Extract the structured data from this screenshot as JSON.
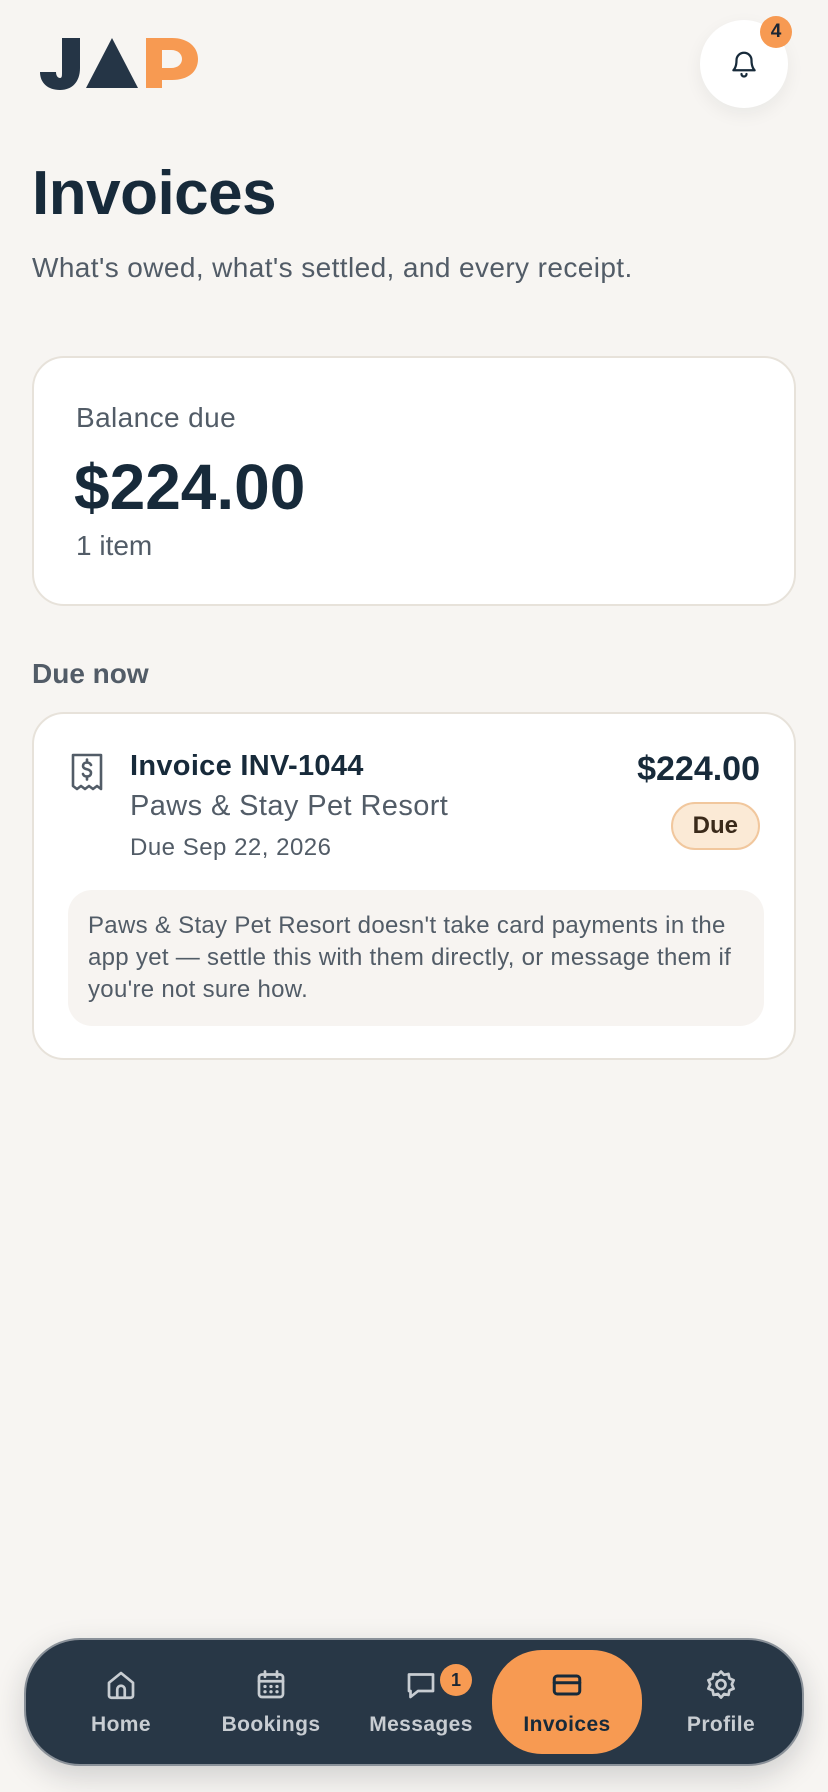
{
  "header": {
    "logo_text": "JAP",
    "notifications_count": "4"
  },
  "page": {
    "title": "Invoices",
    "subtitle": "What's owed, what's settled, and every receipt."
  },
  "balance": {
    "label": "Balance due",
    "amount": "$224.00",
    "count": "1 item"
  },
  "due_now": {
    "section_label": "Due now",
    "invoices": [
      {
        "title": "Invoice INV-1044",
        "vendor": "Paws & Stay Pet Resort",
        "due_date": "Due Sep 22, 2026",
        "amount": "$224.00",
        "status": "Due",
        "note": "Paws & Stay Pet Resort doesn't take card payments in the app yet — settle this with them directly, or message them if you're not sure how."
      }
    ]
  },
  "nav": {
    "items": [
      {
        "label": "Home",
        "icon": "home-icon"
      },
      {
        "label": "Bookings",
        "icon": "calendar-icon"
      },
      {
        "label": "Messages",
        "icon": "chat-bubble-icon",
        "badge": "1"
      },
      {
        "label": "Invoices",
        "icon": "credit-card-icon",
        "active": true
      },
      {
        "label": "Profile",
        "icon": "gear-icon"
      }
    ]
  },
  "colors": {
    "accent": "#f79a52",
    "navy": "#172a3a",
    "nav_bg": "#283746",
    "page_bg": "#f7f5f2"
  }
}
